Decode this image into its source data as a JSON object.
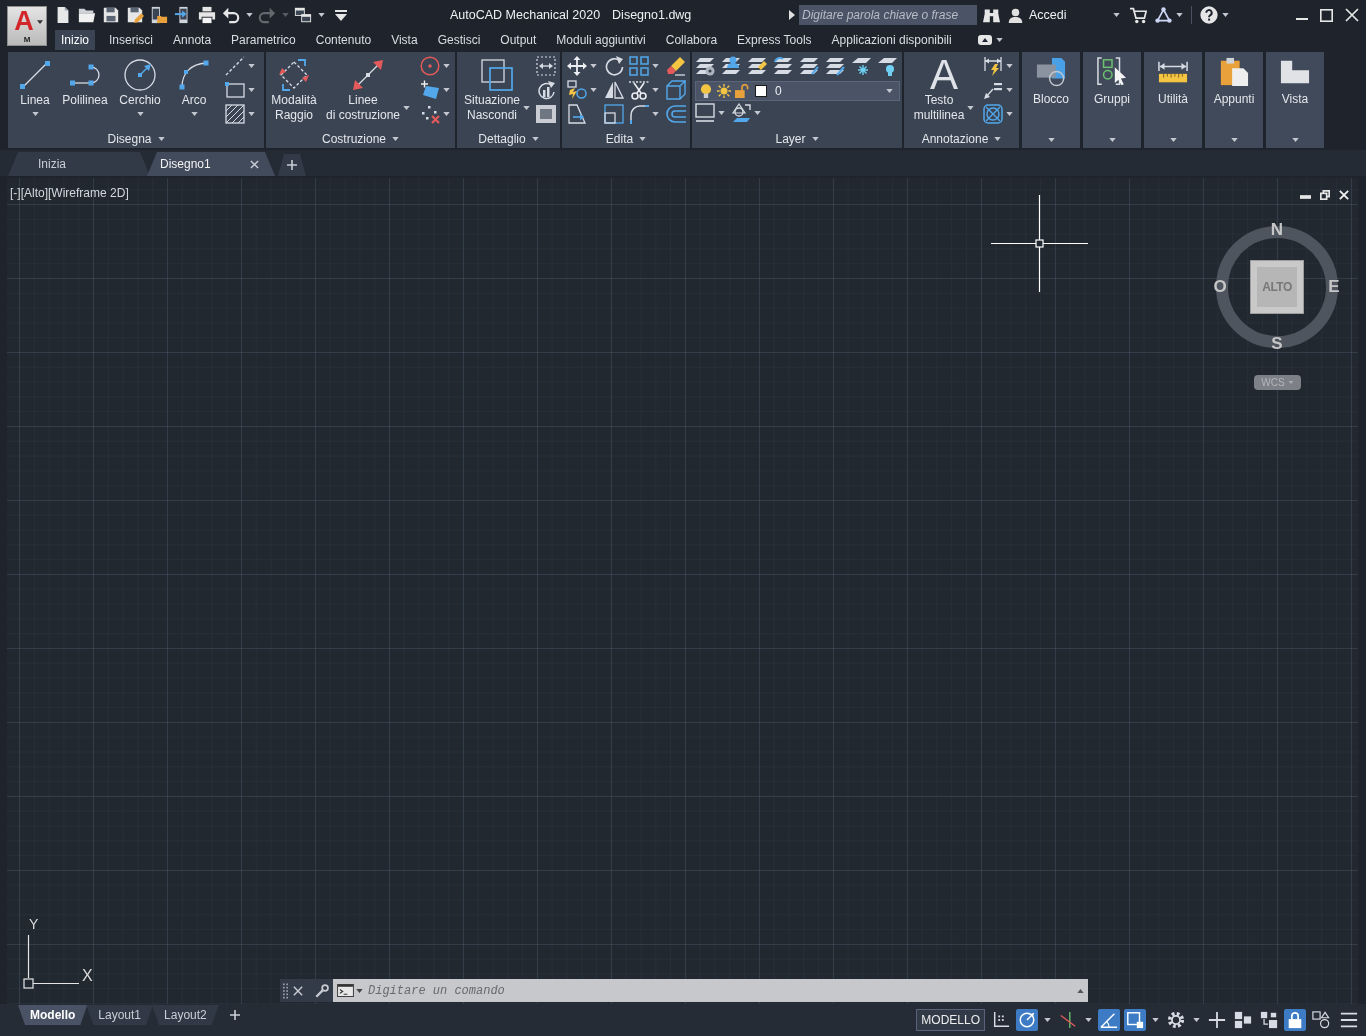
{
  "app_button": {
    "logo": "A",
    "badge": "M"
  },
  "quick_access": [
    {
      "disabled": false
    },
    {
      "disabled": false
    },
    {
      "disabled": false
    },
    {
      "disabled": false
    },
    {
      "disabled": false
    },
    {
      "disabled": false
    },
    {
      "disabled": false
    },
    {
      "disabled": false
    },
    {
      "disabled": true
    },
    {
      "disabled": false
    },
    {
      "disabled": false
    }
  ],
  "window": {
    "title": "AutoCAD Mechanical 2020",
    "document": "Disegno1.dwg"
  },
  "search": {
    "placeholder": "Digitare parola chiave o frase"
  },
  "account": {
    "label": "Accedi"
  },
  "ribbon_tabs": [
    {
      "label": "Inizio",
      "selected": true
    },
    {
      "label": "Inserisci",
      "selected": false
    },
    {
      "label": "Annota",
      "selected": false
    },
    {
      "label": "Parametrico",
      "selected": false
    },
    {
      "label": "Contenuto",
      "selected": false
    },
    {
      "label": "Vista",
      "selected": false
    },
    {
      "label": "Gestisci",
      "selected": false
    },
    {
      "label": "Output",
      "selected": false
    },
    {
      "label": "Moduli aggiuntivi",
      "selected": false
    },
    {
      "label": "Collabora",
      "selected": false
    },
    {
      "label": "Express Tools",
      "selected": false
    },
    {
      "label": "Applicazioni disponibili",
      "selected": false
    }
  ],
  "ribbon_panels": [
    {
      "kind": "draw",
      "title": "Disegna",
      "tools": [
        {
          "label": "Linea"
        },
        {
          "label": "Polilinea"
        },
        {
          "label": "Cerchio"
        },
        {
          "label": "Arco"
        }
      ]
    },
    {
      "kind": "construction",
      "title": "Costruzione",
      "tools": [
        {
          "label": "Modalità\nRaggio"
        },
        {
          "label": "Linee\ndi costruzione"
        }
      ]
    },
    {
      "kind": "detail",
      "title": "Dettaglio",
      "tools": [
        {
          "label": "Situazione\nNascondi"
        }
      ]
    },
    {
      "kind": "modify",
      "title": "Edita"
    },
    {
      "kind": "layers",
      "title": "Layer",
      "current_layer": {
        "name": "0",
        "on": true,
        "frozen": false,
        "locked": false
      }
    },
    {
      "kind": "annotation",
      "title": "Annotazione",
      "tools": [
        {
          "glyph": "A",
          "label": "Testo\nmultilinea"
        }
      ]
    }
  ],
  "collapsed_panels": [
    {
      "label": "Blocco"
    },
    {
      "label": "Gruppi"
    },
    {
      "label": "Utilità"
    },
    {
      "label": "Appunti"
    },
    {
      "label": "Vista"
    }
  ],
  "file_tabs": [
    {
      "label": "Inizia",
      "selected": false,
      "closable": false
    },
    {
      "label": "Disegno1",
      "selected": true,
      "closable": true
    }
  ],
  "viewport": {
    "controls": [
      {
        "label": "[-]"
      },
      {
        "label": "[Alto]"
      },
      {
        "label": "[Wireframe 2D]"
      }
    ],
    "viewcube": {
      "north": "N",
      "west": "O",
      "east": "E",
      "south": "S",
      "face": "ALTO",
      "coordinate_system": "WCS"
    },
    "ucs_icon": {
      "x_label": "X",
      "y_label": "Y"
    }
  },
  "command_line": {
    "placeholder": "Digitare un comando"
  },
  "layout_tabs": [
    {
      "label": "Modello",
      "selected": true
    },
    {
      "label": "Layout1",
      "selected": false
    },
    {
      "label": "Layout2",
      "selected": false
    }
  ],
  "status_bar": {
    "space": "MODELLO",
    "toggles": [
      {
        "on": false
      },
      {
        "on": true
      },
      {
        "on": false
      },
      {
        "on": true
      },
      {
        "on": true
      },
      {
        "on": false
      },
      {
        "on": false
      },
      {
        "on": false
      },
      {
        "on": false
      },
      {
        "on": true
      },
      {
        "on": false
      }
    ]
  }
}
